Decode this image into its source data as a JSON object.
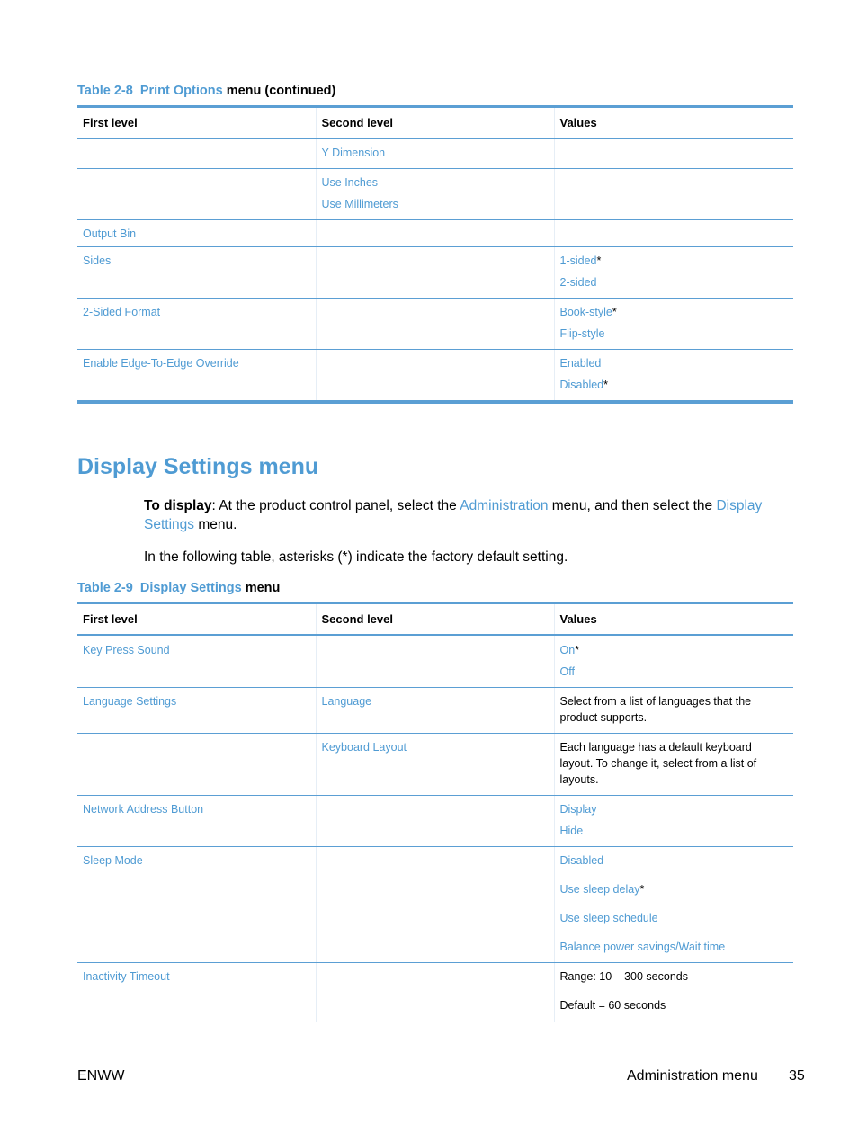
{
  "table1": {
    "caption_label": "Table 2-8",
    "caption_name": "Print Options",
    "caption_suffix": "menu (continued)",
    "headers": [
      "First level",
      "Second level",
      "Values"
    ],
    "rows": [
      {
        "first": "",
        "second": [
          "Y Dimension"
        ],
        "values": []
      },
      {
        "first": "",
        "second": [
          "Use Inches",
          "Use Millimeters"
        ],
        "values": []
      },
      {
        "first": "Output Bin",
        "second": [],
        "values": []
      },
      {
        "first": "Sides",
        "second": [],
        "values": [
          {
            "text": "1-sided",
            "default": "*"
          },
          {
            "text": "2-sided",
            "default": ""
          }
        ]
      },
      {
        "first": "2-Sided Format",
        "second": [],
        "values": [
          {
            "text": "Book-style",
            "default": "*"
          },
          {
            "text": "Flip-style",
            "default": ""
          }
        ]
      },
      {
        "first": "Enable Edge-To-Edge Override",
        "second": [],
        "values": [
          {
            "text": "Enabled",
            "default": ""
          },
          {
            "text": "Disabled",
            "default": "*"
          }
        ]
      }
    ]
  },
  "section": {
    "title": "Display Settings menu",
    "intro_bold": "To display",
    "intro_part1": ": At the product control panel, select the ",
    "intro_link1": "Administration",
    "intro_part2": " menu, and then select the ",
    "intro_link2": "Display Settings",
    "intro_part3": " menu.",
    "note": "In the following table, asterisks (*) indicate the factory default setting."
  },
  "table2": {
    "caption_label": "Table 2-9",
    "caption_name": "Display Settings",
    "caption_suffix": "menu",
    "headers": [
      "First level",
      "Second level",
      "Values"
    ],
    "rows": [
      {
        "first": "Key Press Sound",
        "second": "",
        "values": [
          {
            "text": "On",
            "default": "*"
          },
          {
            "text": "Off",
            "default": ""
          }
        ]
      },
      {
        "first": "Language Settings",
        "second": "Language",
        "description": "Select from a list of languages that the product supports."
      },
      {
        "first": "",
        "second": "Keyboard Layout",
        "description": "Each language has a default keyboard layout. To change it, select from a list of layouts."
      },
      {
        "first": "Network Address Button",
        "second": "",
        "values": [
          {
            "text": "Display",
            "default": ""
          },
          {
            "text": "Hide",
            "default": ""
          }
        ]
      },
      {
        "first": "Sleep Mode",
        "second": "",
        "values": [
          {
            "text": "Disabled",
            "default": ""
          },
          {
            "text": "Use sleep delay",
            "default": "*"
          },
          {
            "text": "Use sleep schedule",
            "default": ""
          },
          {
            "text": "Balance power savings/Wait time",
            "default": ""
          }
        ]
      },
      {
        "first": "Inactivity Timeout",
        "second": "",
        "plain_values": [
          "Range: 10 – 300 seconds",
          "Default = 60 seconds"
        ]
      }
    ]
  },
  "footer": {
    "left": "ENWW",
    "section": "Administration menu",
    "page": "35"
  }
}
